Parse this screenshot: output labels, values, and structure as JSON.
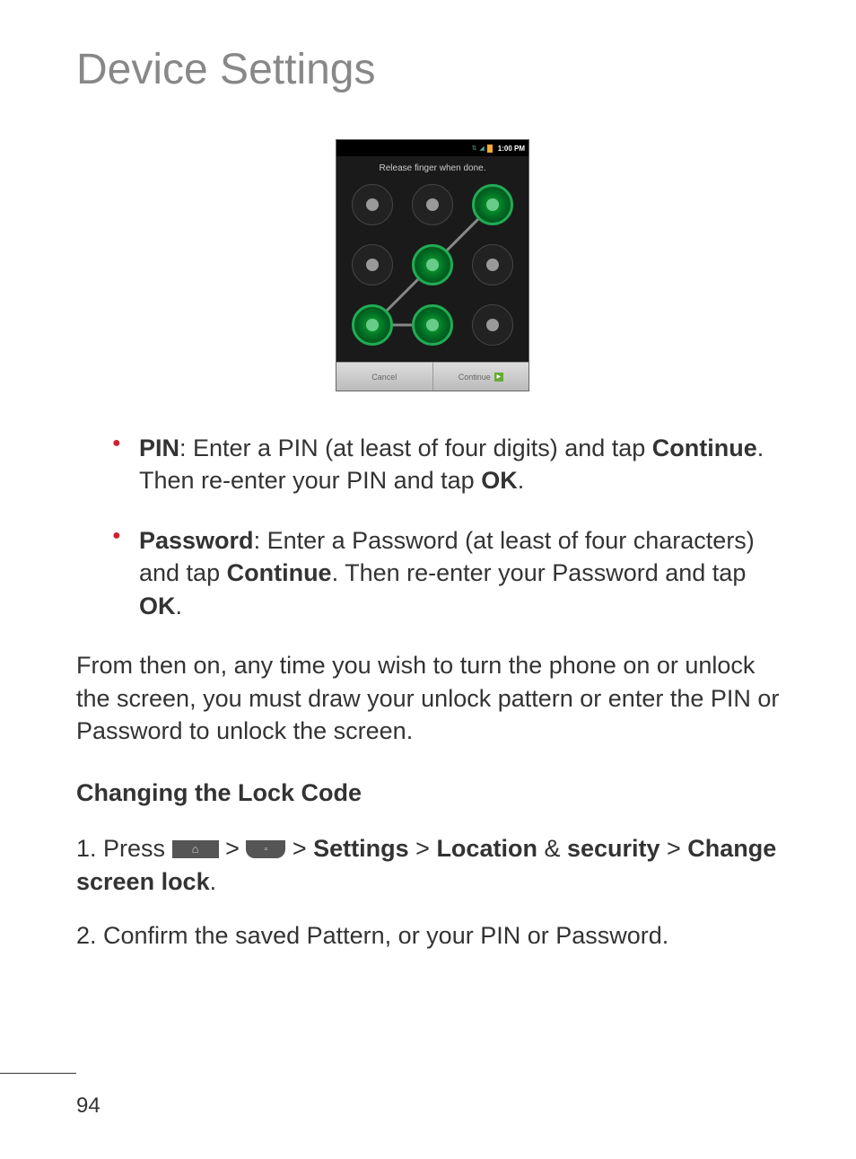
{
  "pageTitle": "Device Settings",
  "phone": {
    "statusTime": "1:00 PM",
    "instruction": "Release finger when done.",
    "cancelLabel": "Cancel",
    "continueLabel": "Continue"
  },
  "bullets": {
    "pin": {
      "label": "PIN",
      "text1": ": Enter a PIN (at least of four digits) and tap ",
      "bold1": "Continue",
      "text2": ". Then re-enter your PIN and tap ",
      "bold2": "OK",
      "text3": "."
    },
    "password": {
      "label": "Password",
      "text1": ": Enter a Password (at least of four characters) and tap ",
      "bold1": "Continue",
      "text2": ". Then re-enter your Password and tap ",
      "bold2": "OK",
      "text3": "."
    }
  },
  "bodyText": "From then on, any time you wish to turn the phone on or unlock the screen, you must draw your unlock pattern or enter the PIN or Password to unlock the screen.",
  "sectionHeading": "Changing the Lock Code",
  "steps": {
    "s1": {
      "prefix": "1. Press ",
      "gt1": " > ",
      "gt2": " > ",
      "b1": "Settings",
      "gt3": " > ",
      "b2": "Location",
      "amp": " & ",
      "b3": "security",
      "gt4": " > ",
      "b4": "Change screen lock",
      "end": "."
    },
    "s2": "2. Confirm the saved Pattern, or your PIN or Password."
  },
  "pageNumber": "94"
}
